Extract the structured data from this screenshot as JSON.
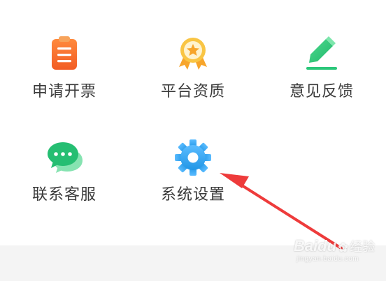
{
  "menu": {
    "items": [
      {
        "label": "申请开票",
        "icon": "invoice-clipboard-icon",
        "color": "#f56b2a"
      },
      {
        "label": "平台资质",
        "icon": "award-ribbon-icon",
        "color": "#f7b53a"
      },
      {
        "label": "意见反馈",
        "icon": "pen-edit-icon",
        "color": "#2bc77a"
      },
      {
        "label": "联系客服",
        "icon": "chat-bubbles-icon",
        "color": "#2bc77a"
      },
      {
        "label": "系统设置",
        "icon": "gear-icon",
        "color": "#3aa8f0"
      }
    ]
  },
  "annotation": {
    "arrow_color": "#ee3b3b"
  },
  "watermark": {
    "brand": "Baidu",
    "brand_cn": "经验",
    "url": "jingyan.baidu.com"
  }
}
